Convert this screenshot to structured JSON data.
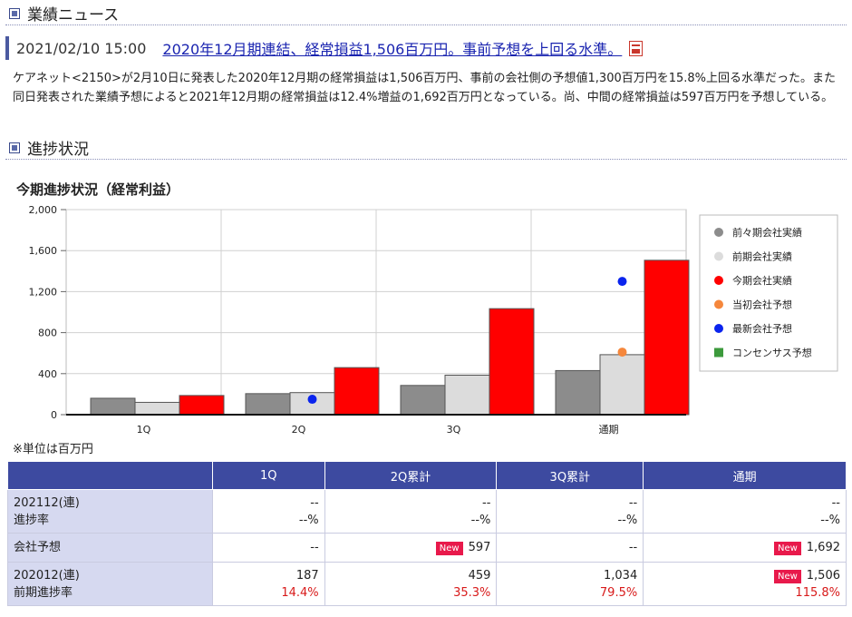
{
  "sections": {
    "news_title": "業績ニュース",
    "progress_title": "進捗状況"
  },
  "news": {
    "date": "2021/02/10 15:00",
    "headline": "2020年12月期連結、経常損益1,506百万円。事前予想を上回る水準。",
    "body": "ケアネット<2150>が2月10日に発表した2020年12月期の経常損益は1,506百万円、事前の会社側の予想値1,300百万円を15.8%上回る水準だった。また同日発表された業績予想によると2021年12月期の経常損益は12.4%増益の1,692百万円となっている。尚、中間の経常損益は597百万円を予想している。"
  },
  "chart_data": {
    "type": "bar",
    "title": "今期進捗状況（経常利益）",
    "categories": [
      "1Q",
      "2Q",
      "3Q",
      "通期"
    ],
    "ylim": [
      0,
      2000
    ],
    "yticks": [
      "0",
      "400",
      "800",
      "1,200",
      "1,600",
      "2,000"
    ],
    "ytick_values": [
      0,
      400,
      800,
      1200,
      1600,
      2000
    ],
    "grid": true,
    "legend_position": "right",
    "series": [
      {
        "name": "前々期会社実績",
        "kind": "bar",
        "color": "#8c8c8c",
        "values": [
          160,
          205,
          285,
          430
        ]
      },
      {
        "name": "前期会社実績",
        "kind": "bar",
        "color": "#dcdcdc",
        "values": [
          120,
          215,
          385,
          585
        ]
      },
      {
        "name": "今期会社実績",
        "kind": "bar",
        "color": "#ff0000",
        "values": [
          187,
          459,
          1034,
          1506
        ]
      },
      {
        "name": "当初会社予想",
        "kind": "dot",
        "color": "#f5873c",
        "values": [
          null,
          null,
          null,
          610
        ]
      },
      {
        "name": "最新会社予想",
        "kind": "dot",
        "color": "#0a24ee",
        "values": [
          null,
          150,
          null,
          1300
        ]
      },
      {
        "name": "コンセンサス予想",
        "kind": "dot",
        "color": "#3c9a3c",
        "legend_shape": "square",
        "values": [
          null,
          null,
          null,
          null
        ]
      }
    ]
  },
  "unit_note": "※単位は百万円",
  "table": {
    "headers": [
      "",
      "1Q",
      "2Q累計",
      "3Q累計",
      "通期"
    ],
    "new_label": "New",
    "rows": [
      {
        "label1": "202112(連)",
        "label2": "進捗率",
        "cells": [
          {
            "v1": "--",
            "v2": "--%"
          },
          {
            "v1": "--",
            "v2": "--%"
          },
          {
            "v1": "--",
            "v2": "--%"
          },
          {
            "v1": "--",
            "v2": "--%"
          }
        ]
      },
      {
        "label1": "会社予想",
        "cells": [
          {
            "v1": "--"
          },
          {
            "v1": "597",
            "new": true
          },
          {
            "v1": "--"
          },
          {
            "v1": "1,692",
            "new": true
          }
        ]
      },
      {
        "label1": "202012(連)",
        "label2": "前期進捗率",
        "cells": [
          {
            "v1": "187",
            "v2": "14.4%"
          },
          {
            "v1": "459",
            "v2": "35.3%"
          },
          {
            "v1": "1,034",
            "v2": "79.5%"
          },
          {
            "v1": "1,506",
            "new": true,
            "v2": "115.8%"
          }
        ]
      }
    ]
  }
}
